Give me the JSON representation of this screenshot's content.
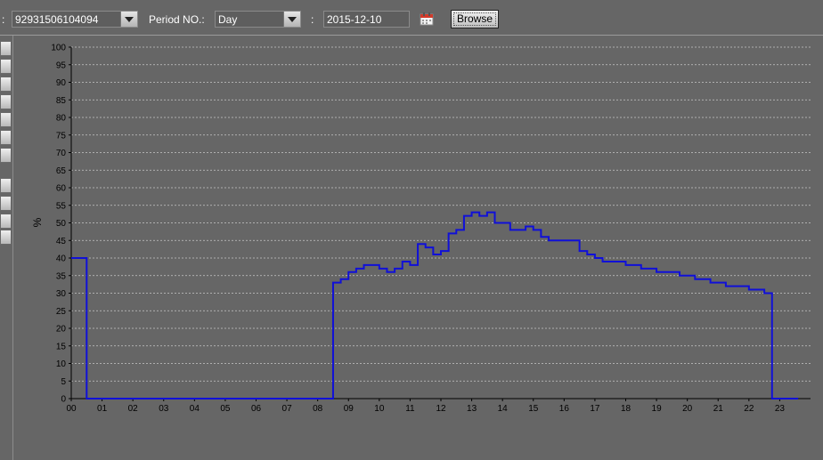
{
  "toolbar": {
    "colon_left": ":",
    "device_id": "92931506104094",
    "period_label": "Period NO.:",
    "period_value": "Day",
    "colon_mid": ":",
    "date_value": "2015-12-10",
    "browse_label": "Browse"
  },
  "chart_data": {
    "type": "line",
    "step": true,
    "ylabel": "%",
    "xlabel": "",
    "ylim": [
      0,
      100
    ],
    "yticks": [
      0,
      5,
      10,
      15,
      20,
      25,
      30,
      35,
      40,
      45,
      50,
      55,
      60,
      65,
      70,
      75,
      80,
      85,
      90,
      95,
      100
    ],
    "xlim": [
      0,
      24
    ],
    "xticks": [
      "00",
      "01",
      "02",
      "03",
      "04",
      "05",
      "06",
      "07",
      "08",
      "09",
      "10",
      "11",
      "12",
      "13",
      "14",
      "15",
      "16",
      "17",
      "18",
      "19",
      "20",
      "21",
      "22",
      "23"
    ],
    "grid": true,
    "line_color": "#1010d8",
    "series": [
      {
        "x": [
          0,
          0.5,
          8.5,
          8.75,
          9.0,
          9.25,
          9.5,
          10.0,
          10.25,
          10.5,
          10.75,
          11.0,
          11.25,
          11.5,
          11.75,
          12.0,
          12.25,
          12.5,
          12.75,
          13.0,
          13.25,
          13.5,
          13.75,
          14.25,
          14.75,
          15.0,
          15.25,
          15.5,
          16.5,
          16.75,
          17.0,
          17.25,
          18.0,
          18.5,
          19.0,
          19.75,
          20.25,
          20.75,
          21.25,
          22.0,
          22.5,
          22.75,
          23.5
        ],
        "y": [
          40,
          0,
          33,
          34,
          36,
          37,
          38,
          37,
          36,
          37,
          39,
          38,
          44,
          43,
          41,
          42,
          47,
          48,
          52,
          53,
          52,
          53,
          50,
          48,
          49,
          48,
          46,
          45,
          42,
          41,
          40,
          39,
          38,
          37,
          36,
          35,
          34,
          33,
          32,
          31,
          30,
          0,
          0
        ]
      }
    ]
  }
}
